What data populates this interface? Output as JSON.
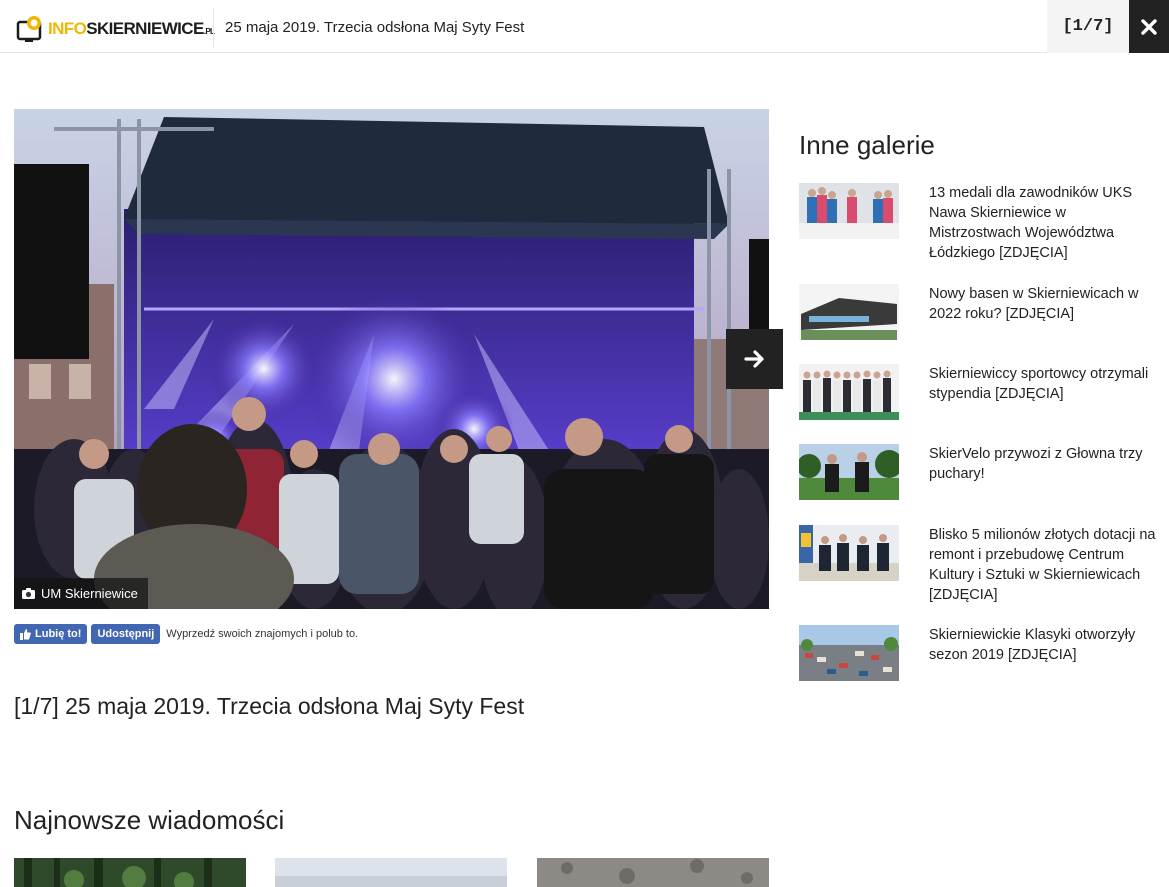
{
  "header": {
    "logo_text_highlight": "INFO",
    "logo_text_main": "SKIERNIEWICE",
    "logo_text_suffix": ".PL",
    "gallery_title": "25 maja 2019. Trzecia odsłona Maj Syty Fest",
    "counter": "[1/7]",
    "close_icon": "close-icon"
  },
  "photo": {
    "credit": "UM Skierniewice",
    "next_icon": "arrow-right-icon"
  },
  "facebook": {
    "like_label": "Lubię to!",
    "share_label": "Udostępnij",
    "text": "Wyprzedź swoich znajomych i polub to."
  },
  "caption": "[1/7] 25 maja 2019. Trzecia odsłona Maj Syty Fest",
  "latest": {
    "title": "Najnowsze wiadomości"
  },
  "sidebar": {
    "title": "Inne galerie",
    "items": [
      {
        "label": "13 medali dla zawodników UKS Nawa Skierniewice w Mistrzostwach Województwa Łódzkiego [ZDJĘCIA]"
      },
      {
        "label": "Nowy basen w Skierniewicach w 2022 roku? [ZDJĘCIA]"
      },
      {
        "label": "Skierniewiccy sportowcy otrzymali stypendia [ZDJĘCIA]"
      },
      {
        "label": "SkierVelo przywozi z Głowna trzy puchary!"
      },
      {
        "label": "Blisko 5 milionów złotych dotacji na remont i przebudowę Centrum Kultury i Sztuki w Skierniewicach [ZDJĘCIA]"
      },
      {
        "label": "Skierniewickie Klasyki otworzyły sezon 2019 [ZDJĘCIA]"
      }
    ]
  },
  "colors": {
    "accent": "#f2b705",
    "dark": "#222222",
    "facebook": "#4267b2"
  }
}
